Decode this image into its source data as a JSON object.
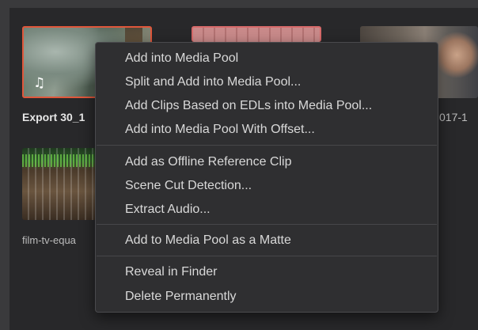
{
  "media_pool": {
    "clips": [
      {
        "label": "Export 30_1",
        "icon": "music-note-icon",
        "selected": true
      },
      {
        "label": "",
        "icon": ""
      },
      {
        "label": "017-1",
        "icon": ""
      },
      {
        "label": "film-tv-equa",
        "icon": ""
      }
    ]
  },
  "context_menu": {
    "groups": [
      [
        "Add into Media Pool",
        "Split and Add into Media Pool...",
        "Add Clips Based on EDLs into Media Pool...",
        "Add into Media Pool With Offset..."
      ],
      [
        "Add as Offline Reference Clip",
        "Scene Cut Detection...",
        "Extract Audio..."
      ],
      [
        "Add to Media Pool as a Matte"
      ],
      [
        "Reveal in Finder",
        "Delete Permanently"
      ]
    ]
  },
  "colors": {
    "selection_border": "#e0573b",
    "menu_background": "#2f2f31",
    "menu_text": "#d9d9d9"
  }
}
